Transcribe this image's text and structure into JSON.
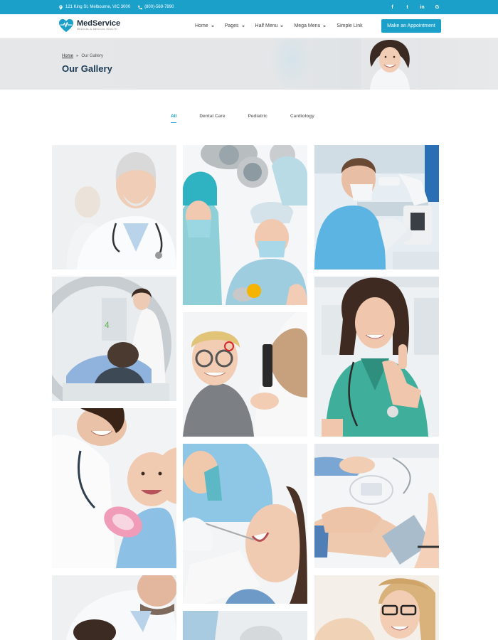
{
  "topbar": {
    "address": "121 King St, Melbourne, VIC 3000",
    "phone": "(800)-569-7890",
    "social": [
      "f",
      "t",
      "in",
      "G"
    ]
  },
  "header": {
    "logo_name": "MedService",
    "logo_tagline": "MEDICAL & MEDICAL HEALTH",
    "nav": [
      {
        "label": "Home"
      },
      {
        "label": "Pages"
      },
      {
        "label": "Half Menu"
      },
      {
        "label": "Mega Menu"
      },
      {
        "label": "Simple Link"
      }
    ],
    "cta_label": "Make an Appointment"
  },
  "banner": {
    "breadcrumb_home": "Home",
    "breadcrumb_sep": "»",
    "breadcrumb_current": "Our Gallery",
    "title": "Our Gallery"
  },
  "filters": [
    "All",
    "Dental Care",
    "Pediatric",
    "Cardiology"
  ],
  "gallery": [
    {
      "name": "doctor-portrait"
    },
    {
      "name": "surgery-team"
    },
    {
      "name": "lab-microscope"
    },
    {
      "name": "mri-scan"
    },
    {
      "name": "eye-exam-child"
    },
    {
      "name": "nurse-thumbs-up"
    },
    {
      "name": "pediatrician-baby"
    },
    {
      "name": "dental-patient"
    },
    {
      "name": "blood-pressure"
    },
    {
      "name": "doctor-checkup"
    },
    {
      "name": "partial-bottom"
    },
    {
      "name": "woman-glasses"
    }
  ],
  "colors": {
    "accent": "#1aa0c9",
    "title": "#1d3c55"
  }
}
